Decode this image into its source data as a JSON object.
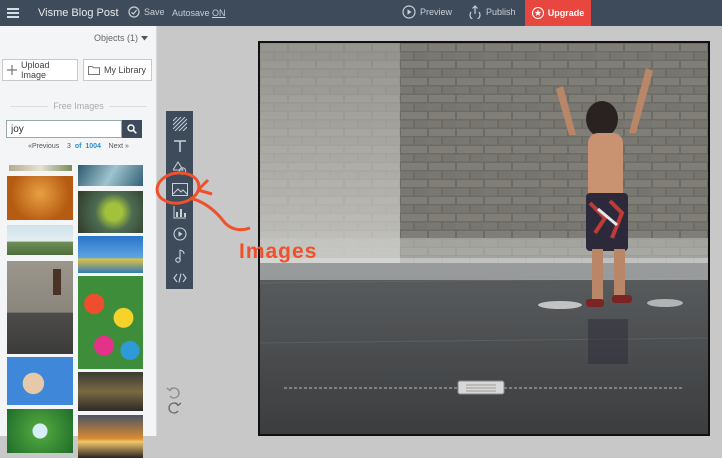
{
  "topbar": {
    "title": "Visme Blog Post",
    "save": "Save",
    "autosave_prefix": "Autosave ",
    "autosave_state": "ON",
    "preview": "Preview",
    "publish": "Publish",
    "upgrade": "Upgrade"
  },
  "left_panel": {
    "objects_label": "Objects (1)",
    "upload_label": "Upload Image",
    "library_label": "My Library",
    "section_title": "Free Images",
    "search_value": "joy",
    "pager": {
      "prev": "«Previous",
      "current": "3",
      "of": "of",
      "total": "1004",
      "next": "Next »"
    }
  },
  "annotation": {
    "label": "Images"
  },
  "colors": {
    "topbar": "#3e4b5b",
    "upgrade": "#e8473f",
    "accent": "#2a8fd0",
    "annotation": "#f0502a"
  }
}
